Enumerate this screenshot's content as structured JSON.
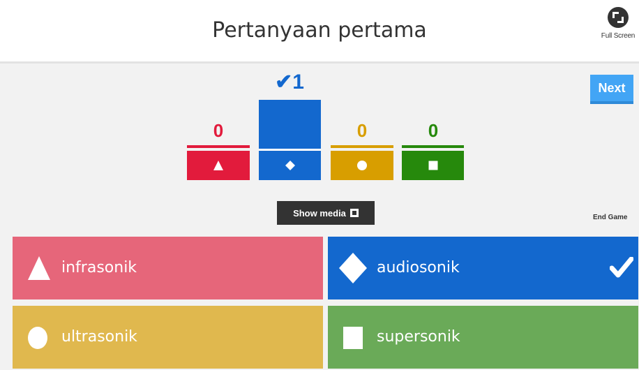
{
  "header": {
    "title": "Pertanyaan pertama",
    "fullscreen_label": "Full Screen"
  },
  "controls": {
    "next_label": "Next",
    "show_media_label": "Show media",
    "end_game_label": "End Game"
  },
  "results": {
    "correct_marker": "✔",
    "counts": [
      {
        "shape": "triangle",
        "count": "0",
        "color": "#e21b3c"
      },
      {
        "shape": "diamond",
        "count": "1",
        "color": "#1368ce",
        "correct": true
      },
      {
        "shape": "circle",
        "count": "0",
        "color": "#d89e00"
      },
      {
        "shape": "square",
        "count": "0",
        "color": "#26890c"
      }
    ]
  },
  "answers": [
    {
      "shape": "triangle",
      "label": "infrasonik",
      "color": "#e6667a",
      "correct": false
    },
    {
      "shape": "diamond",
      "label": "audiosonik",
      "color": "#1368ce",
      "correct": true
    },
    {
      "shape": "circle",
      "label": "ultrasonik",
      "color": "#e0b84e",
      "correct": false
    },
    {
      "shape": "square",
      "label": "supersonik",
      "color": "#6aaa58",
      "correct": false
    }
  ],
  "icons": {
    "fullscreen": "fullscreen-icon",
    "media": "image-icon",
    "check": "check-icon"
  }
}
